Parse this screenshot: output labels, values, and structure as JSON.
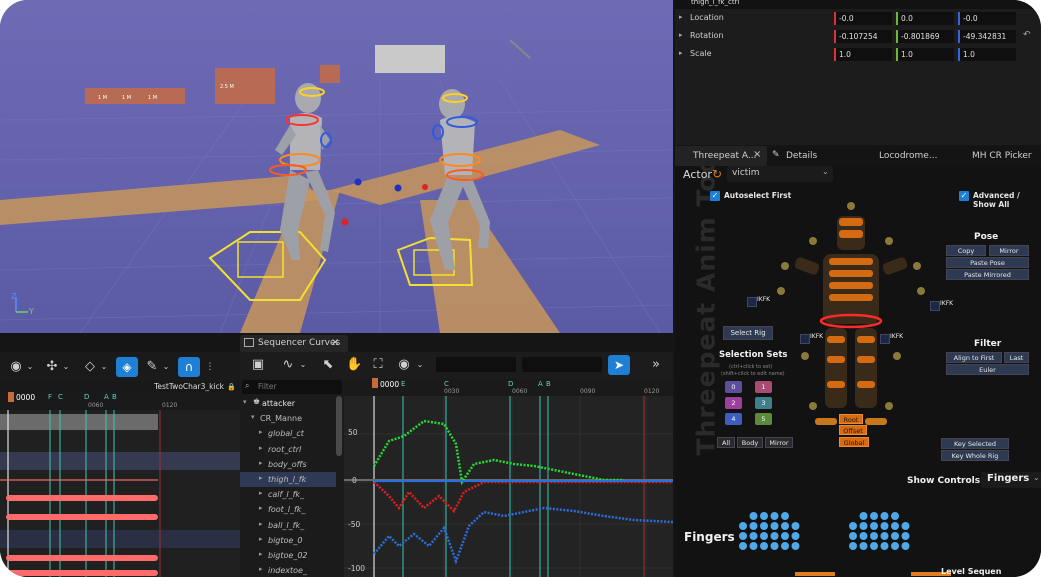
{
  "viewport": {
    "distance_labels": [
      "1 M",
      "1 M",
      "1 M",
      "2.5 M"
    ],
    "axis_z": "Z",
    "axis_y": "Y"
  },
  "toolbar": {
    "eye_icon": "eye-icon",
    "snap_icon": "magnet-icon"
  },
  "sequencer": {
    "tab_label": "Sequencer Curves",
    "sequence_name": "TestTwoChar3_kick",
    "frame_start": "0000",
    "frame_markers_left": [
      "F",
      "C",
      "D",
      "A",
      "B"
    ],
    "frame_ticks_left": [
      "0060",
      "0120"
    ],
    "frame_markers_curves": [
      "E",
      "C",
      "D",
      "A",
      "B"
    ],
    "frame_ticks_curves": [
      "0030",
      "0060",
      "0090",
      "0120"
    ],
    "filter_placeholder": "Filter",
    "y_ticks": [
      "50",
      "0",
      "-50",
      "-100"
    ],
    "outliner_items": [
      {
        "label": "attacker",
        "level": 0
      },
      {
        "label": "CR_Manne",
        "level": 1
      },
      {
        "label": "global_ct",
        "level": 2
      },
      {
        "label": "root_ctrl",
        "level": 2
      },
      {
        "label": "body_offs",
        "level": 2
      },
      {
        "label": "thigh_l_fk",
        "level": 2
      },
      {
        "label": "calf_l_fk_",
        "level": 2
      },
      {
        "label": "foot_l_fk_",
        "level": 2
      },
      {
        "label": "ball_l_fk_",
        "level": 2
      },
      {
        "label": "bigtoe_0",
        "level": 2
      },
      {
        "label": "bigtoe_02",
        "level": 2
      },
      {
        "label": "indextoe_",
        "level": 2
      }
    ]
  },
  "details": {
    "title": "thigh_l_fk_ctrl",
    "rows": [
      {
        "label": "Location",
        "x": "-0.0",
        "y": "0.0",
        "z": "-0.0"
      },
      {
        "label": "Rotation",
        "x": "-0.107254",
        "y": "-0.801869",
        "z": "-49.342831"
      },
      {
        "label": "Scale",
        "x": "1.0",
        "y": "1.0",
        "z": "1.0"
      }
    ]
  },
  "tabs": [
    {
      "label": "Threepeat A...",
      "active": true
    },
    {
      "label": "Details",
      "active": false
    },
    {
      "label": "Locodrome...",
      "active": false
    },
    {
      "label": "MH CR Picker",
      "active": false
    }
  ],
  "tools": {
    "watermark": "Threepeat Anim Tools",
    "actor_label": "Actor",
    "actor_value": "victim",
    "autoselect_label": "Autoselect First",
    "advanced_label": "Advanced / Show All",
    "pose_title": "Pose",
    "pose_buttons": [
      "Copy",
      "Mirror",
      "Paste Pose",
      "Paste Mirrored"
    ],
    "ikfk_labels": [
      "IKFK",
      "IKFK",
      "IKFK",
      "IKFK"
    ],
    "select_rig": "Select Rig",
    "selection_sets_title": "Selection Sets",
    "selection_hint_1": "(ctrl+click to set)",
    "selection_hint_2": "(shift+click to edit name)",
    "selection_nums": [
      "0",
      "1",
      "2",
      "3",
      "4",
      "5"
    ],
    "selection_bottom": [
      "All",
      "Body",
      "Mirror"
    ],
    "filter_title": "Filter",
    "filter_buttons": [
      "Align to First",
      "Last",
      "Euler"
    ],
    "root_buttons": [
      "Root",
      "Offset",
      "Global"
    ],
    "key_buttons": [
      "Key Selected",
      "Key Whole Rig"
    ],
    "show_controls_label": "Show Controls",
    "show_controls_value": "Fingers",
    "fingers_title": "Fingers",
    "level_sequence": "Level Sequen"
  },
  "colors": {
    "accent": "#1e7fd4",
    "curve_red": "#e02020",
    "curve_green": "#22dd33",
    "curve_blue": "#2a6fe0",
    "keyframe_red": "#ff6b6b",
    "viewport_floor": "#5f5ea8"
  }
}
